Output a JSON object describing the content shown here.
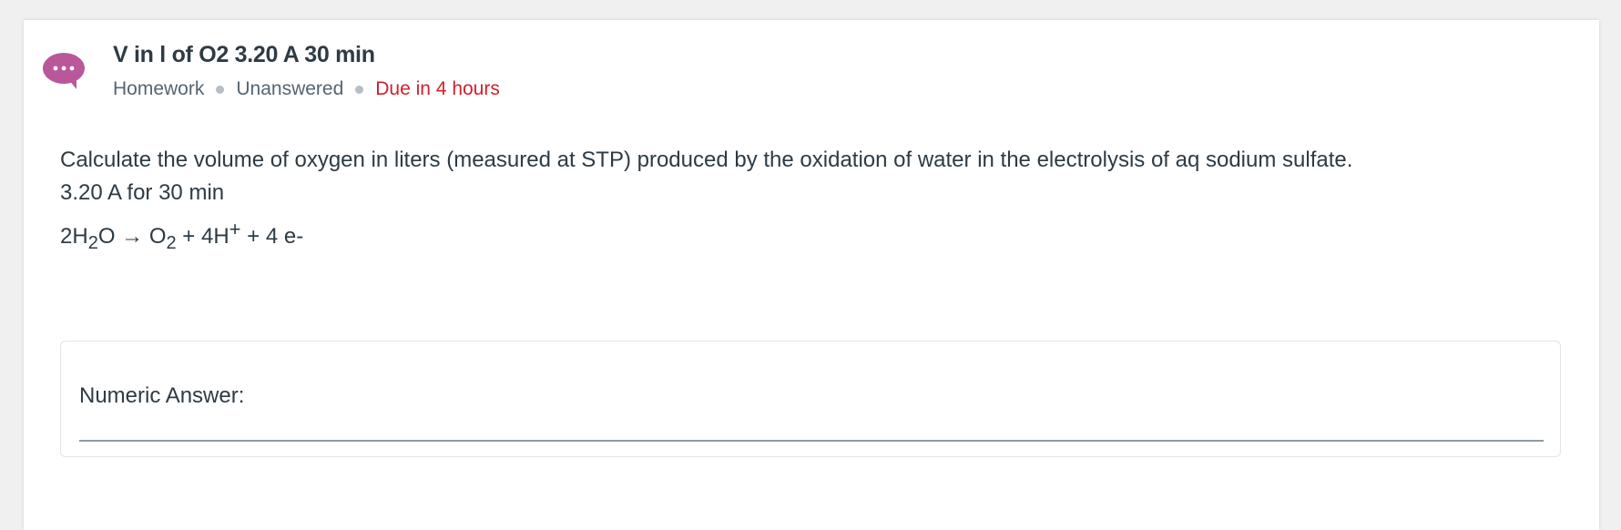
{
  "header": {
    "title": "V in l of O2 3.20 A 30 min",
    "icon": "chat-bubble-icon",
    "meta": {
      "type": "Homework",
      "status": "Unanswered",
      "due": "Due in 4 hours"
    }
  },
  "question": {
    "line1": "Calculate the volume of oxygen in liters (measured at STP) produced by the oxidation of water in the electrolysis of aq sodium sulfate.",
    "line2": "3.20 A for 30 min",
    "equation": {
      "reactant_prefix": "2H",
      "reactant_sub": "2",
      "reactant_suffix": "O",
      "arrow": "→",
      "product1": "O",
      "product1_sub": "2",
      "plus1": "+ 4H",
      "charge": "+",
      "plus2": "+ 4 e-"
    }
  },
  "answer": {
    "label": "Numeric Answer:",
    "value": "",
    "placeholder": ""
  },
  "colors": {
    "accent_pink": "#b9579a",
    "due_red": "#d0212a",
    "text": "#2d3b45",
    "muted": "#556572"
  }
}
